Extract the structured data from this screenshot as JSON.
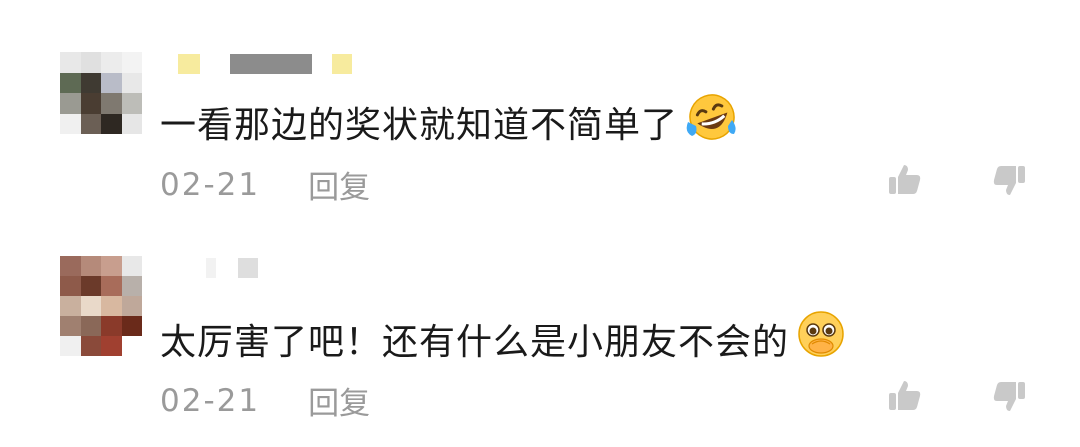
{
  "comments": [
    {
      "text": "一看那边的奖状就知道不简单了",
      "emoji": "laughing-tears-icon",
      "date": "02-21",
      "reply_label": "回复",
      "like_icon": "thumbs-up-icon",
      "dislike_icon": "thumbs-down-icon"
    },
    {
      "text": "太厉害了吧！还有什么是小朋友不会的",
      "emoji": "pleading-face-icon",
      "date": "02-21",
      "reply_label": "回复",
      "like_icon": "thumbs-up-icon",
      "dislike_icon": "thumbs-down-icon"
    }
  ],
  "colors": {
    "text": "#1a1a1a",
    "meta": "#9a9a9a",
    "username_highlight": "#f7eb9e",
    "username_gray": "#8c8c8c",
    "icon": "#c9c9c9"
  }
}
